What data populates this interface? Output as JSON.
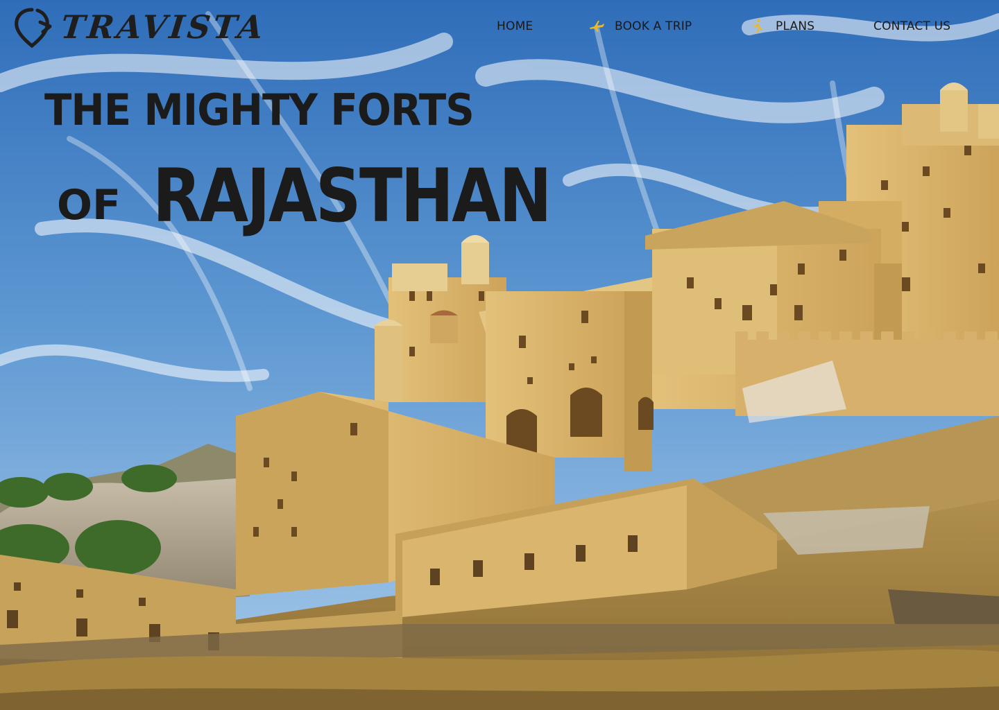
{
  "brand": {
    "name": "TRAVISTA"
  },
  "nav": {
    "items": [
      {
        "label": "HOME",
        "icon": ""
      },
      {
        "label": "BOOK A TRIP",
        "icon": "airplane-icon"
      },
      {
        "label": "PLANS",
        "icon": "walking-person-icon"
      },
      {
        "label": "CONTACT US",
        "icon": ""
      }
    ]
  },
  "hero": {
    "title_line1": "THE MIGHTY FORTS",
    "title_of": "OF",
    "title_line2": "RAJASTHAN",
    "image": "amber-fort-photo"
  },
  "colors": {
    "sky_top": "#3a76c0",
    "sky_bottom": "#8fb9e0",
    "fort": "#d8b56a",
    "fort_shadow": "#b08a45",
    "hill": "#a98a4c",
    "text": "#1b1b1b",
    "icon_accent": "#e8b82e"
  }
}
